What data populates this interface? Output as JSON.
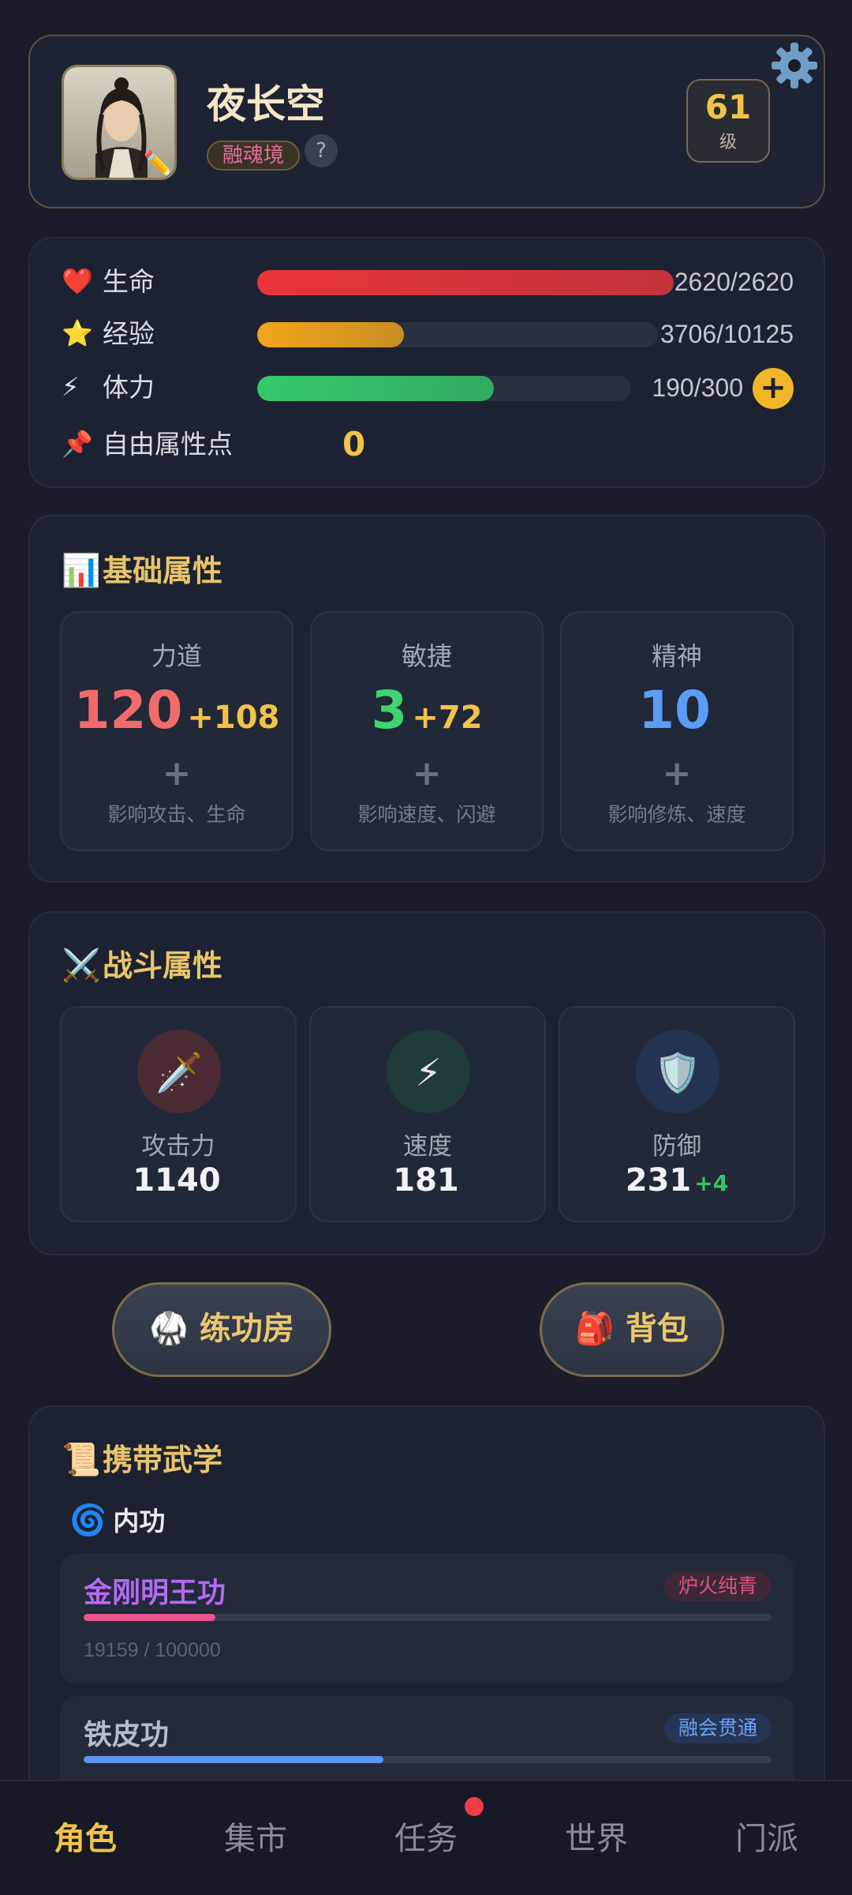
{
  "profile": {
    "name": "夜长空",
    "realm": "融魂境",
    "help": "?",
    "level": "61",
    "level_unit": "级",
    "icons": {
      "avatar": "avatar-portrait",
      "edit": "pencil-icon",
      "settings": "gear-icon"
    }
  },
  "stats": {
    "hp": {
      "icon": "❤️",
      "label": "生命",
      "value": "2620/2620",
      "fraction": 1.0,
      "color": "#e8343a"
    },
    "exp": {
      "icon": "⭐",
      "label": "经验",
      "value": "3706/10125",
      "fraction": 0.366,
      "color": "#f2a51b"
    },
    "stamina": {
      "icon": "⚡",
      "label": "体力",
      "value": "190/300",
      "fraction": 0.633,
      "color": "#34c96b"
    },
    "stamina_add": "+",
    "free_points": {
      "icon": "📌",
      "label": "自由属性点",
      "value": "0"
    }
  },
  "base": {
    "icon": "📊",
    "title": "基础属性",
    "attrs": [
      {
        "name": "力道",
        "value": "120",
        "bonus": "+108",
        "plus": "+",
        "desc": "影响攻击、生命",
        "color": "#f26b6b"
      },
      {
        "name": "敏捷",
        "value": "3",
        "bonus": "+72",
        "plus": "+",
        "desc": "影响速度、闪避",
        "color": "#3ed46f"
      },
      {
        "name": "精神",
        "value": "10",
        "bonus": "",
        "plus": "+",
        "desc": "影响修炼、速度",
        "color": "#5b9cf5"
      }
    ]
  },
  "combat": {
    "icon": "⚔️",
    "title": "战斗属性",
    "items": [
      {
        "icon": "🗡️",
        "name": "攻击力",
        "value": "1140",
        "bonus": "",
        "bg": "#4a2a33"
      },
      {
        "icon": "⚡",
        "name": "速度",
        "value": "181",
        "bonus": "",
        "bg": "#1f3b3a"
      },
      {
        "icon": "🛡️",
        "name": "防御",
        "value": "231",
        "bonus": "+4",
        "bg": "#233452"
      }
    ]
  },
  "actions": {
    "training": {
      "icon": "🥋",
      "label": "练功房"
    },
    "bag": {
      "icon": "🎒",
      "label": "背包"
    }
  },
  "martial": {
    "icon": "📜",
    "title": "携带武学",
    "neigong": {
      "icon": "🌀",
      "label": "内功"
    },
    "skills": [
      {
        "name": "金刚明王功",
        "tag": "炉火纯青",
        "progress": "19159 / 100000",
        "fraction": 0.19159,
        "name_color": "#b46af2",
        "tag_color": "#e2507e",
        "tag_bg": "#3d2838",
        "bar_color": "#e9558f"
      },
      {
        "name": "铁皮功",
        "tag": "融会贯通",
        "progress": "",
        "fraction": 0.436,
        "name_color": "#b8bcc8",
        "tag_color": "#6ea1f2",
        "tag_bg": "#243556",
        "bar_color": "#5d97f0"
      }
    ]
  },
  "nav": {
    "items": [
      "角色",
      "集市",
      "任务",
      "世界",
      "门派"
    ],
    "active": 0,
    "badge_on": "任务"
  }
}
